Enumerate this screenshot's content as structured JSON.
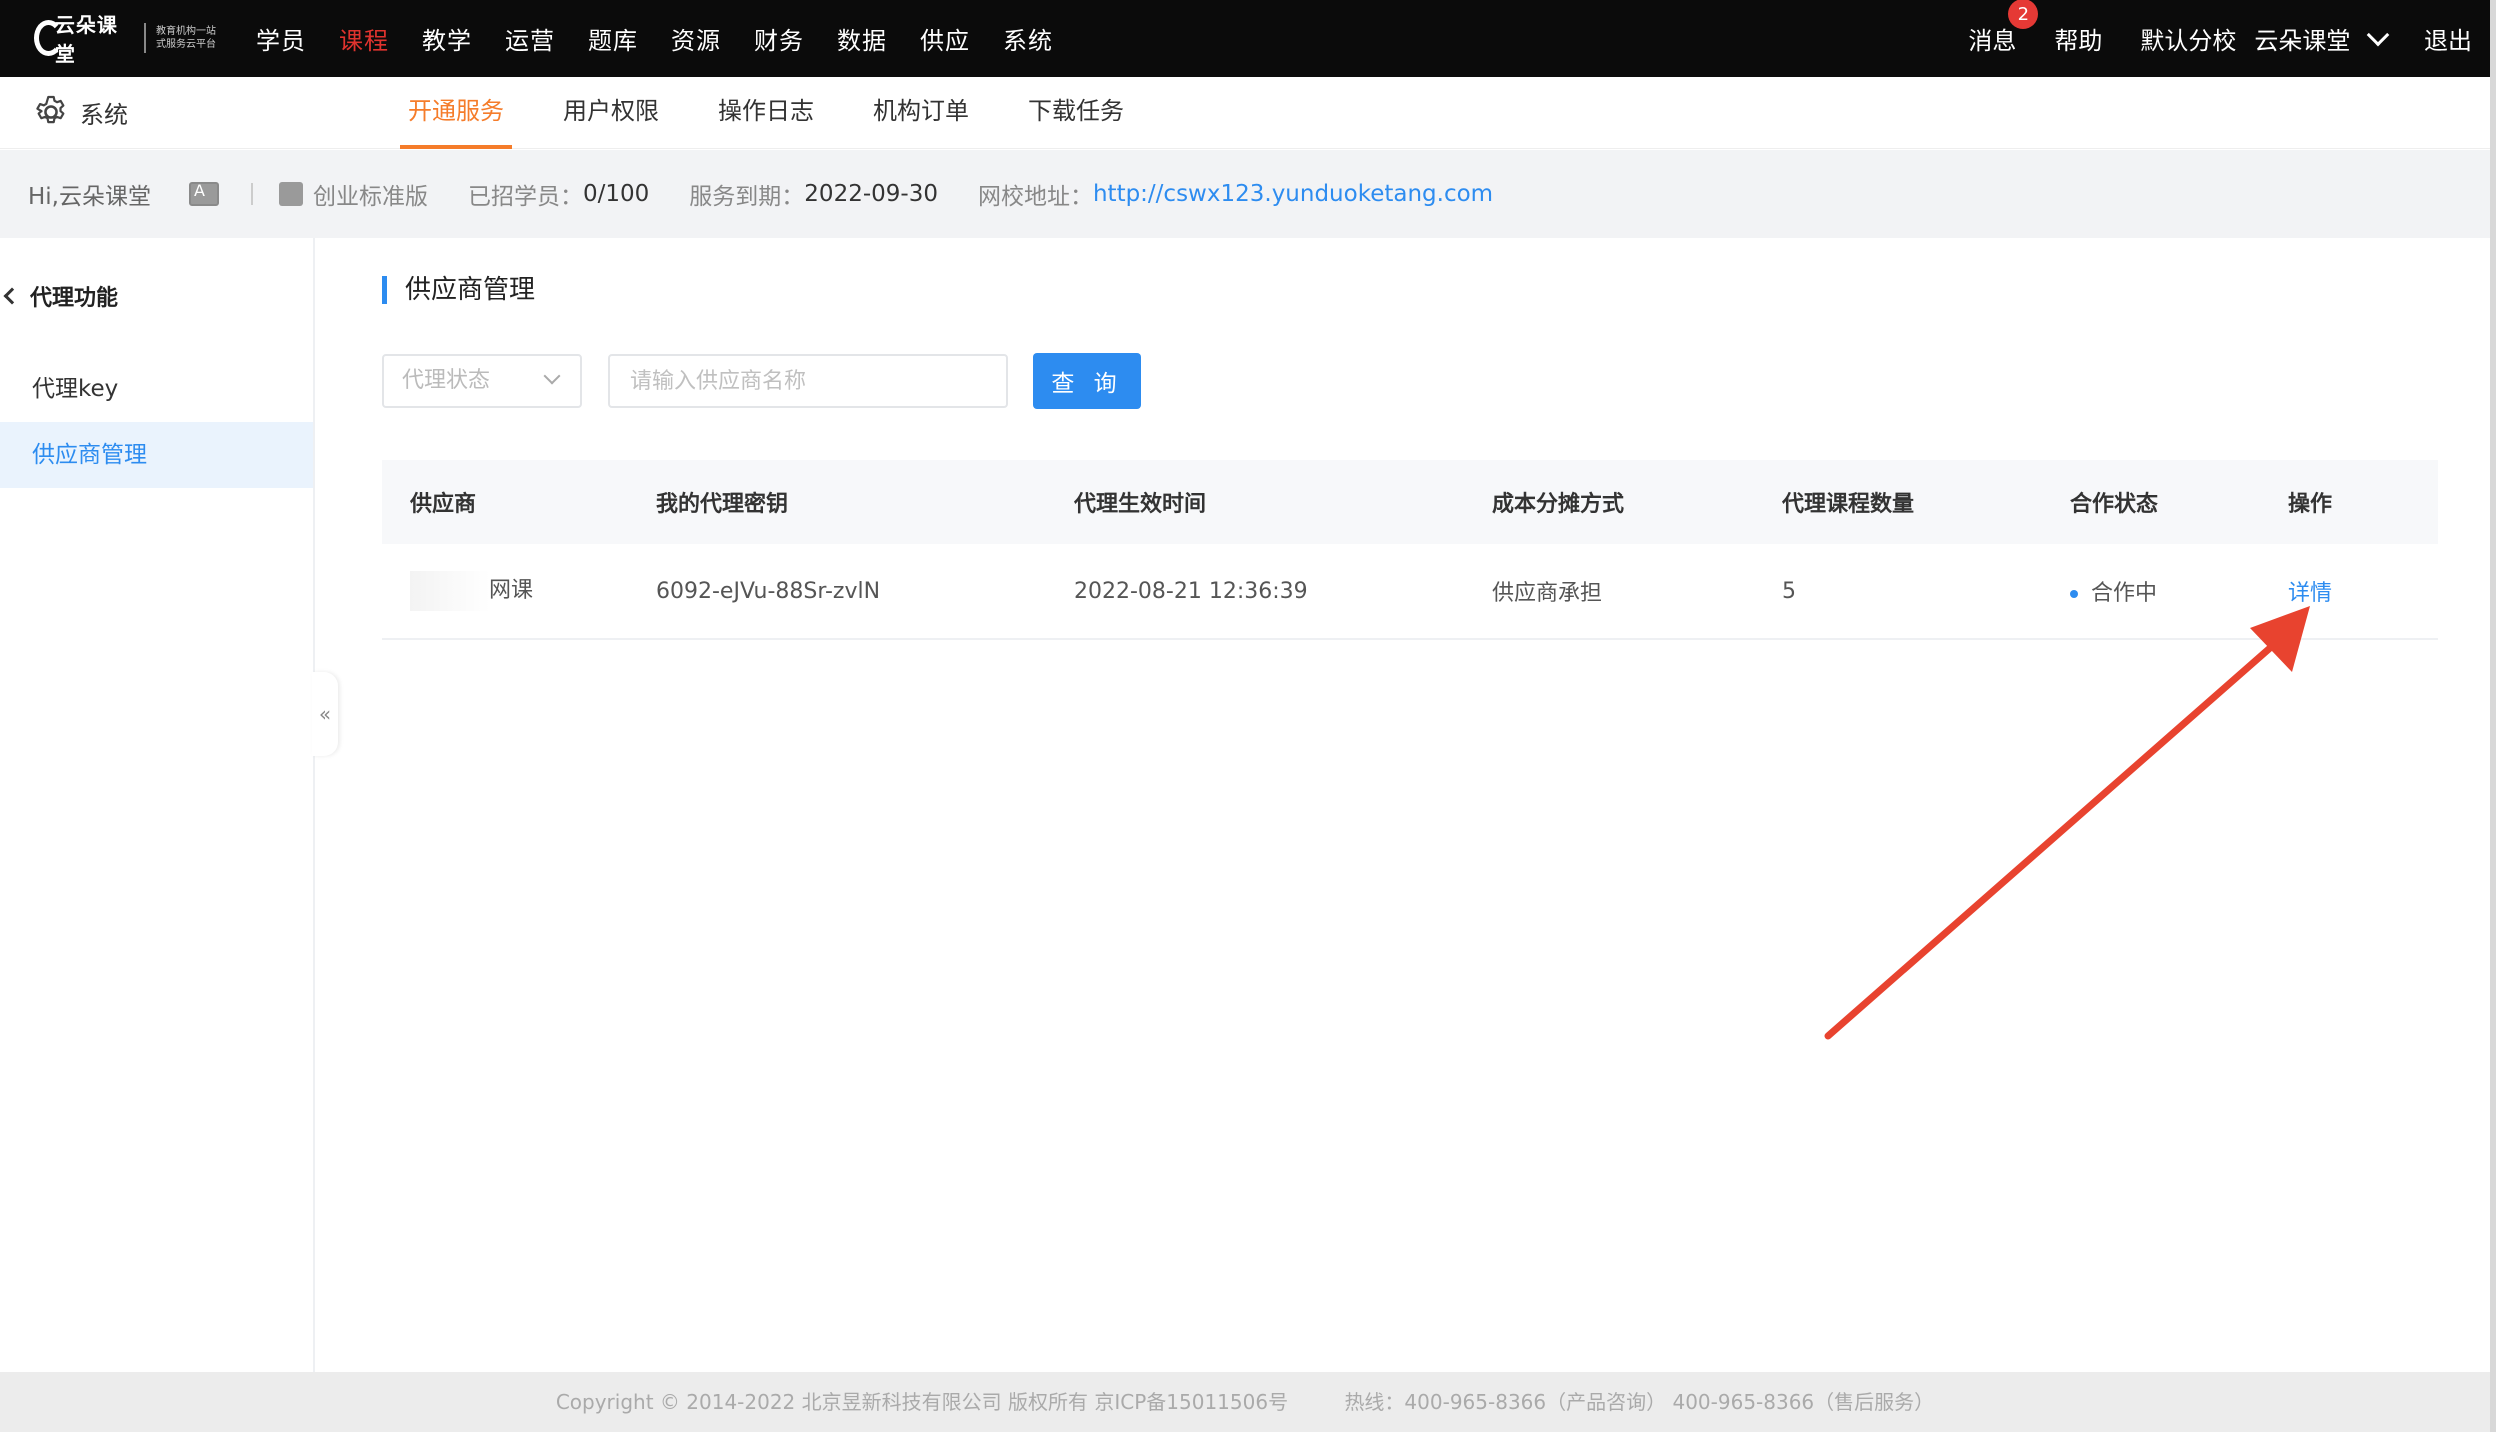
{
  "topbar": {
    "logo_text": "云朵课堂",
    "logo_sub": "教育机构一站式服务云平台",
    "nav": [
      {
        "label": "学员",
        "active": false
      },
      {
        "label": "课程",
        "active": true
      },
      {
        "label": "教学",
        "active": false
      },
      {
        "label": "运营",
        "active": false
      },
      {
        "label": "题库",
        "active": false
      },
      {
        "label": "资源",
        "active": false
      },
      {
        "label": "财务",
        "active": false
      },
      {
        "label": "数据",
        "active": false
      },
      {
        "label": "供应",
        "active": false
      },
      {
        "label": "系统",
        "active": false
      }
    ],
    "messages_label": "消息",
    "messages_badge": "2",
    "help_label": "帮助",
    "branch_label": "默认分校",
    "account_label": "云朵课堂",
    "logout_label": "退出"
  },
  "subbar": {
    "section_label": "系统",
    "tabs": [
      {
        "label": "开通服务",
        "active": true
      },
      {
        "label": "用户权限",
        "active": false
      },
      {
        "label": "操作日志",
        "active": false
      },
      {
        "label": "机构订单",
        "active": false
      },
      {
        "label": "下载任务",
        "active": false
      }
    ]
  },
  "infobar": {
    "greeting": "Hi,云朵课堂",
    "edition": "创业标准版",
    "students_label": "已招学员：",
    "students_value": "0/100",
    "expiry_label": "服务到期：",
    "expiry_value": "2022-09-30",
    "site_label": "网校地址：",
    "site_url": "http://cswx123.yunduoketang.com"
  },
  "sidebar": {
    "header": "代理功能",
    "items": [
      {
        "label": "代理key",
        "active": false
      },
      {
        "label": "供应商管理",
        "active": true
      }
    ],
    "collapse_glyph": "«"
  },
  "main": {
    "title": "供应商管理",
    "filter_select_value": "代理状态",
    "search_placeholder": "请输入供应商名称",
    "query_button": "查 询",
    "table": {
      "headers": [
        "供应商",
        "我的代理密钥",
        "代理生效时间",
        "成本分摊方式",
        "代理课程数量",
        "合作状态",
        "操作"
      ],
      "rows": [
        {
          "supplier": "网课",
          "key": "6092-eJVu-88Sr-zvlN",
          "effective_time": "2022-08-21 12:36:39",
          "cost_share": "供应商承担",
          "course_count": "5",
          "status": "合作中",
          "action": "详情"
        }
      ]
    }
  },
  "footer": {
    "copyright": "Copyright © 2014-2022 北京昱新科技有限公司 版权所有 京ICP备15011506号",
    "hotline": "热线：400-965-8366（产品咨询） 400-965-8366（售后服务）"
  },
  "colors": {
    "accent_blue": "#2d8cf0",
    "active_orange": "#f57c2a",
    "nav_active_red": "#e0332e",
    "annotation_red": "#e8432f"
  }
}
